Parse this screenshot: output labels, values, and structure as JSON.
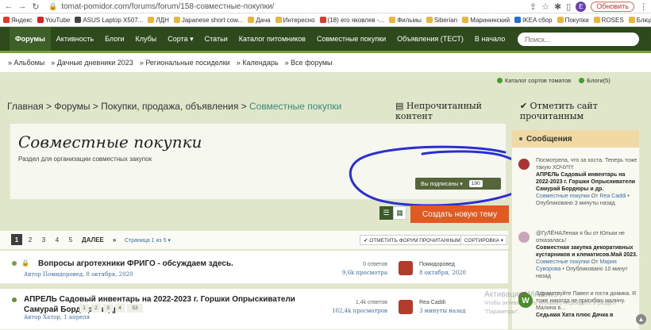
{
  "browser": {
    "url": "tomat-pomidor.com/forums/forum/158-совместные-покупки/",
    "avatar_letter": "E",
    "update_label": "Обновить",
    "bookmarks": [
      {
        "label": "Яндекс",
        "color": "#e03a2a"
      },
      {
        "label": "YouTube",
        "color": "#e02020"
      },
      {
        "label": "ASUS Laptop X507...",
        "color": "#444444"
      },
      {
        "label": "ЛДН",
        "color": "#e6b640"
      },
      {
        "label": "Japanese short cow...",
        "color": "#e6b640"
      },
      {
        "label": "Дача",
        "color": "#e6b640"
      },
      {
        "label": "Интересно",
        "color": "#e6b640"
      },
      {
        "label": "(18) его яковлев -...",
        "color": "#e03a2a"
      },
      {
        "label": "Фильмы",
        "color": "#e6b640"
      },
      {
        "label": "Siberian",
        "color": "#e6b640"
      },
      {
        "label": "Марининский",
        "color": "#e6b640"
      },
      {
        "label": "IKEA сбор",
        "color": "#2a6fd4"
      },
      {
        "label": "Покупки",
        "color": "#e6b640"
      },
      {
        "label": "ROSES",
        "color": "#e6b640"
      },
      {
        "label": "Блюда",
        "color": "#e6b640"
      }
    ]
  },
  "nav": {
    "items": [
      "Форумы",
      "Активность",
      "Блоги",
      "Клубы",
      "Сорта ▾",
      "Статьи",
      "Каталог питомников",
      "Совместные покупки",
      "Объявления (ТЕСТ)",
      "В начало"
    ],
    "search_placeholder": "Поиск..."
  },
  "subnav": [
    "» Альбомы",
    "» Дачные дневники 2023",
    "» Региональные посиделки",
    "» Календарь",
    "» Все форумы"
  ],
  "util_links": [
    "Каталог сортов томатов",
    "Блоги(5)"
  ],
  "breadcrumb": {
    "home": "Главная",
    "forums": "Форумы",
    "section": "Покупки, продажа, объявления",
    "current": "Совместные покупки",
    "sep": " > "
  },
  "bc_actions": {
    "unread": "Непрочитанный контент",
    "mark_read": "Отметить сайт прочитанным"
  },
  "forum": {
    "title": "Совместные покупки",
    "description": "Раздел для организации совместных закупок",
    "subscribe_label": "Вы подписаны ▾",
    "subscribe_count": "190",
    "create_label": "Создать новую тему"
  },
  "pager": {
    "pages": [
      "1",
      "2",
      "3",
      "4",
      "5"
    ],
    "next": "ДАЛЕЕ",
    "last": "»",
    "page_of": "Страница 1 из 5 ▾",
    "mark_read": "✔ ОТМЕТИТЬ ФОРУМ ПРОЧИТАННЫМ",
    "sort": "СОРТИРОВКА ▾"
  },
  "topics": [
    {
      "title": "Вопросы агротехники ФРИГО - обсуждаем здесь.",
      "author": "Автор Помидоровед, 8 октября, 2020",
      "answers": "0 ответов",
      "views": "9,6k просмотра",
      "last_user": "Помидоровед",
      "last_date": "8 октября, 2020"
    },
    {
      "title": "АПРЕЛЬ Садовый инвентарь на 2022-2023 г. Горшки Опрыскиватели Самурай Бордюры и др.",
      "author": "Автор Хатор, 1 апреля",
      "answers": "1,4k ответов",
      "views": "102,4k просмотров",
      "last_user": "Rea Caddi",
      "last_date": "3 минуты назад",
      "pages": [
        "1",
        "2",
        "3",
        "4",
        "53"
      ]
    }
  ],
  "sidebar": {
    "title": "Сообщения",
    "items": [
      {
        "quote": "Посмотрела, что за хоста. Теперь тоже такую ХОЧУ!!!!",
        "topic": "АПРЕЛЬ Садовый инвентарь на 2022-2023 г. Горшки Опрыскиватели Самурай Бордюры и др.",
        "section": "Совместные покупки",
        "by": "От",
        "author": "Rea Caddi",
        "time": "• Опубликовано 3 минуты назад"
      },
      {
        "quote": "@ГуЛЁНАЛенаи я бы от Юльки не отказалась!",
        "topic": "Совместная закупка декоративных кустарников и клематисов.Май 2023.",
        "section": "Совместные покупки",
        "by": "От",
        "author": "Мария Суворова",
        "time": "• Опубликовано 10 минут назад"
      },
      {
        "quote": "Здравствуйте Павел и гости домика. Я тоже никогда не пригибаю малину. Малина в...",
        "topic": "Седьмая Хата плюс Дачка в"
      }
    ]
  },
  "watermark": {
    "line1": "Активация Windows",
    "line2": "Чтобы активировать Windows, перейдите в раздел \"Параметры\"."
  },
  "wa_letter": "W"
}
